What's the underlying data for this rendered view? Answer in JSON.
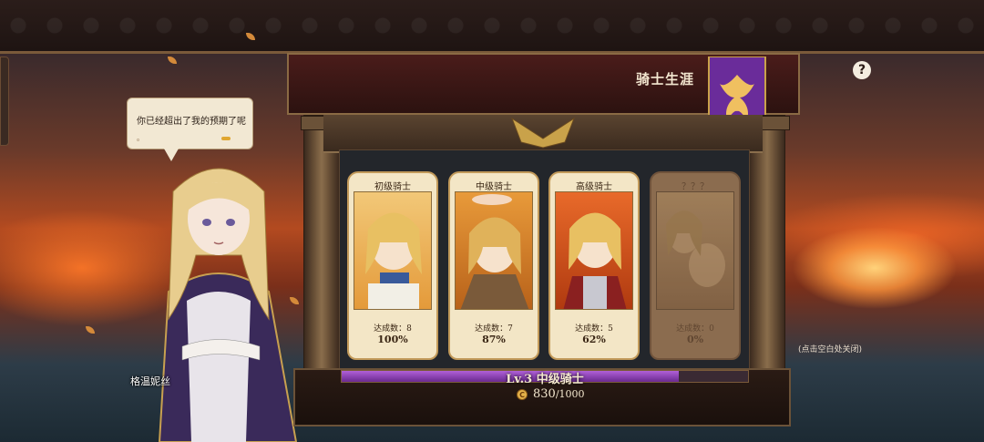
{
  "header": {
    "title": "骑士生涯",
    "help": "?"
  },
  "hint": "(点击空白处关闭)",
  "dialogue": {
    "speaker": "格温妮丝",
    "text": "你已经超出了我的预期了呢",
    "sub": "。"
  },
  "cards": [
    {
      "label": "初级骑士",
      "achievement": "达成数：8",
      "percent": "100%",
      "locked": false
    },
    {
      "label": "中级骑士",
      "achievement": "达成数：7",
      "percent": "87%",
      "locked": false
    },
    {
      "label": "高级骑士",
      "achievement": "达成数：5",
      "percent": "62%",
      "locked": false
    },
    {
      "label": "？？？",
      "achievement": "达成数：0",
      "percent": "0%",
      "locked": true
    }
  ],
  "level": {
    "text": "Lv.3  中级骑士",
    "progress": 0.83
  },
  "currency": {
    "current": "830",
    "max": "/1000",
    "icon": "coin-icon"
  },
  "colors": {
    "accent": "#8a3fb8",
    "panel": "#23262b",
    "gold": "#c29a5a"
  }
}
